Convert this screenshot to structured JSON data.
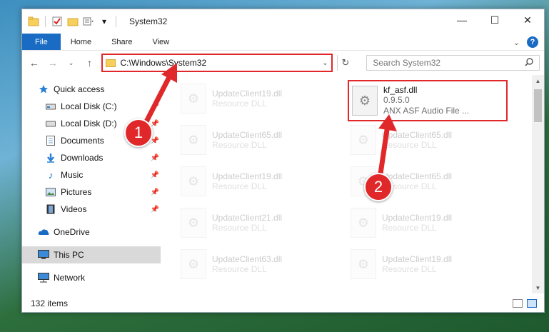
{
  "window": {
    "title": "System32"
  },
  "ribbon": {
    "tabs": [
      "File",
      "Home",
      "Share",
      "View"
    ],
    "help": "?"
  },
  "navbar": {
    "address": "C:\\Windows\\System32",
    "search_placeholder": "Search System32"
  },
  "sidebar": {
    "items": [
      {
        "label": "Quick access",
        "icon": "star-icon"
      },
      {
        "label": "Local Disk (C:)",
        "icon": "drive-icon"
      },
      {
        "label": "Local Disk (D:)",
        "icon": "drive-icon"
      },
      {
        "label": "Documents",
        "icon": "documents-icon"
      },
      {
        "label": "Downloads",
        "icon": "download-icon"
      },
      {
        "label": "Music",
        "icon": "music-icon"
      },
      {
        "label": "Pictures",
        "icon": "pictures-icon"
      },
      {
        "label": "Videos",
        "icon": "videos-icon"
      },
      {
        "label": "OneDrive",
        "icon": "cloud-icon"
      },
      {
        "label": "This PC",
        "icon": "computer-icon"
      },
      {
        "label": "Network",
        "icon": "network-icon"
      }
    ]
  },
  "files": {
    "highlighted": {
      "name": "kf_asf.dll",
      "version": "0.9.5.0",
      "description": "ANX ASF Audio File ..."
    },
    "faded": [
      {
        "name": "UpdateClient19.dll",
        "desc": "Resource DLL"
      },
      {
        "name": "UpdateClient65.dll",
        "desc": "Resource DLL"
      },
      {
        "name": "UpdateClient65.dll",
        "desc": "Resource DLL"
      },
      {
        "name": "UpdateClient19.dll",
        "desc": "Resource DLL"
      },
      {
        "name": "UpdateClient65.dll",
        "desc": "Resource DLL"
      },
      {
        "name": "UpdateClient21.dll",
        "desc": "Resource DLL"
      },
      {
        "name": "UpdateClient19.dll",
        "desc": "Resource DLL"
      },
      {
        "name": "UpdateClient63.dll",
        "desc": "Resource DLL"
      },
      {
        "name": "UpdateClient19.dll",
        "desc": "Resource DLL"
      }
    ]
  },
  "status": {
    "count": "132 items"
  },
  "annotations": {
    "step1": "1",
    "step2": "2"
  },
  "colors": {
    "accent": "#1a6bc4",
    "highlight": "#e0282b"
  }
}
